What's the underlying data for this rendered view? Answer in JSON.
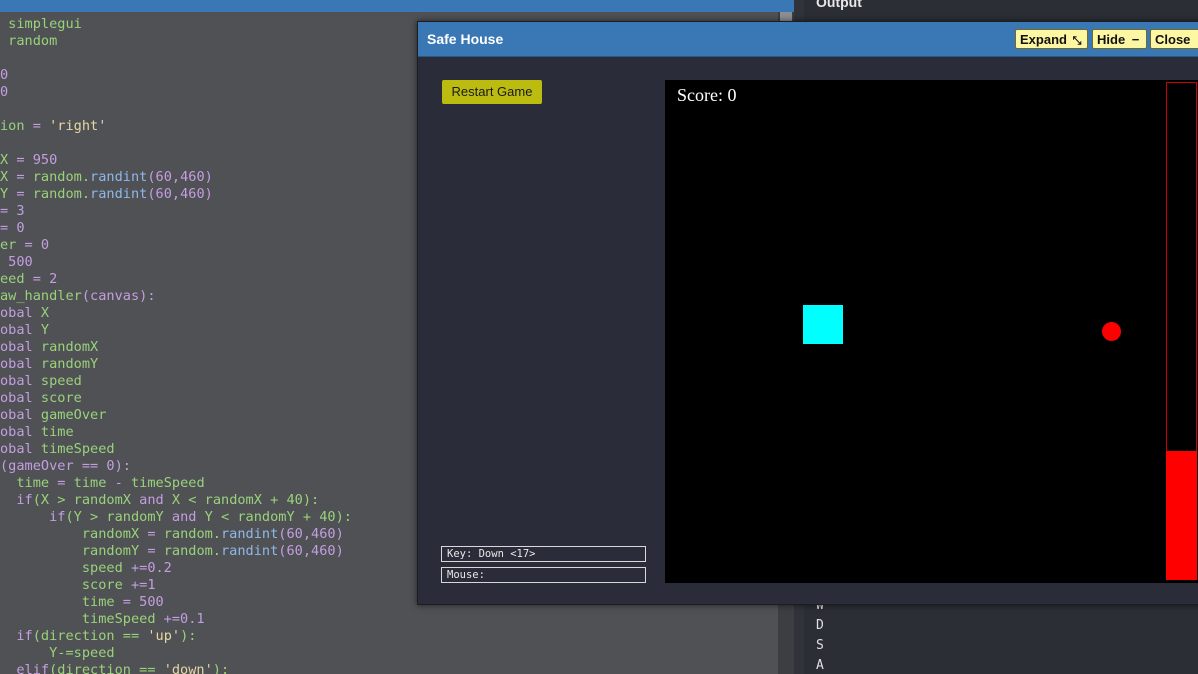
{
  "code_lines": [
    {
      "segs": [
        {
          "t": " simplegui",
          "c": "#9ad27a"
        }
      ]
    },
    {
      "segs": [
        {
          "t": " random",
          "c": "#9ad27a"
        }
      ]
    },
    {
      "segs": []
    },
    {
      "segs": [
        {
          "t": "0",
          "c": "#c49ee0"
        }
      ]
    },
    {
      "segs": [
        {
          "t": "0",
          "c": "#c49ee0"
        }
      ]
    },
    {
      "segs": []
    },
    {
      "segs": [
        {
          "t": "ion",
          "c": "#9ad27a"
        },
        {
          "t": " = ",
          "c": "#c49ee0"
        },
        {
          "t": "'right'",
          "c": "#e6d7a3"
        }
      ]
    },
    {
      "segs": []
    },
    {
      "segs": [
        {
          "t": "X",
          "c": "#9ad27a"
        },
        {
          "t": " = 950",
          "c": "#c49ee0"
        }
      ]
    },
    {
      "segs": [
        {
          "t": "X",
          "c": "#9ad27a"
        },
        {
          "t": " = ",
          "c": "#c49ee0"
        },
        {
          "t": "random.",
          "c": "#9ad27a"
        },
        {
          "t": "randint",
          "c": "#8fb8e8"
        },
        {
          "t": "(60,460)",
          "c": "#c49ee0"
        }
      ]
    },
    {
      "segs": [
        {
          "t": "Y",
          "c": "#9ad27a"
        },
        {
          "t": " = ",
          "c": "#c49ee0"
        },
        {
          "t": "random.",
          "c": "#9ad27a"
        },
        {
          "t": "randint",
          "c": "#8fb8e8"
        },
        {
          "t": "(60,460)",
          "c": "#c49ee0"
        }
      ]
    },
    {
      "segs": [
        {
          "t": "= 3",
          "c": "#c49ee0"
        }
      ]
    },
    {
      "segs": [
        {
          "t": "= 0",
          "c": "#c49ee0"
        }
      ]
    },
    {
      "segs": [
        {
          "t": "er",
          "c": "#9ad27a"
        },
        {
          "t": " = 0",
          "c": "#c49ee0"
        }
      ]
    },
    {
      "segs": [
        {
          "t": " 500",
          "c": "#c49ee0"
        }
      ]
    },
    {
      "segs": [
        {
          "t": "eed",
          "c": "#9ad27a"
        },
        {
          "t": " = 2",
          "c": "#c49ee0"
        }
      ]
    },
    {
      "segs": [
        {
          "t": "aw_handler",
          "c": "#9ad27a"
        },
        {
          "t": "(canvas):",
          "c": "#c49ee0"
        }
      ]
    },
    {
      "segs": [
        {
          "t": "obal",
          "c": "#c49ee0"
        },
        {
          "t": " X",
          "c": "#9ad27a"
        }
      ]
    },
    {
      "segs": [
        {
          "t": "obal",
          "c": "#c49ee0"
        },
        {
          "t": " Y",
          "c": "#9ad27a"
        }
      ]
    },
    {
      "segs": [
        {
          "t": "obal",
          "c": "#c49ee0"
        },
        {
          "t": " randomX",
          "c": "#9ad27a"
        }
      ]
    },
    {
      "segs": [
        {
          "t": "obal",
          "c": "#c49ee0"
        },
        {
          "t": " randomY",
          "c": "#9ad27a"
        }
      ]
    },
    {
      "segs": [
        {
          "t": "obal",
          "c": "#c49ee0"
        },
        {
          "t": " speed",
          "c": "#9ad27a"
        }
      ]
    },
    {
      "segs": [
        {
          "t": "obal",
          "c": "#c49ee0"
        },
        {
          "t": " score",
          "c": "#9ad27a"
        }
      ]
    },
    {
      "segs": [
        {
          "t": "obal",
          "c": "#c49ee0"
        },
        {
          "t": " gameOver",
          "c": "#9ad27a"
        }
      ]
    },
    {
      "segs": [
        {
          "t": "obal",
          "c": "#c49ee0"
        },
        {
          "t": " time",
          "c": "#9ad27a"
        }
      ]
    },
    {
      "segs": [
        {
          "t": "obal",
          "c": "#c49ee0"
        },
        {
          "t": " timeSpeed",
          "c": "#9ad27a"
        }
      ]
    },
    {
      "segs": [
        {
          "t": "(gameOver == 0):",
          "c": "#c49ee0"
        }
      ]
    },
    {
      "segs": [
        {
          "t": "  time",
          "c": "#9ad27a"
        },
        {
          "t": " = ",
          "c": "#c49ee0"
        },
        {
          "t": "time",
          "c": "#9ad27a"
        },
        {
          "t": " - ",
          "c": "#c49ee0"
        },
        {
          "t": "timeSpeed",
          "c": "#9ad27a"
        }
      ]
    },
    {
      "segs": [
        {
          "t": "  if",
          "c": "#c49ee0"
        },
        {
          "t": "(X > randomX ",
          "c": "#9ad27a"
        },
        {
          "t": "and",
          "c": "#c49ee0"
        },
        {
          "t": " X < randomX + 40):",
          "c": "#9ad27a"
        }
      ]
    },
    {
      "segs": [
        {
          "t": "      if",
          "c": "#c49ee0"
        },
        {
          "t": "(Y > randomY ",
          "c": "#9ad27a"
        },
        {
          "t": "and",
          "c": "#c49ee0"
        },
        {
          "t": " Y < randomY + 40):",
          "c": "#9ad27a"
        }
      ]
    },
    {
      "segs": [
        {
          "t": "          randomX",
          "c": "#9ad27a"
        },
        {
          "t": " = ",
          "c": "#c49ee0"
        },
        {
          "t": "random.",
          "c": "#9ad27a"
        },
        {
          "t": "randint",
          "c": "#8fb8e8"
        },
        {
          "t": "(60,460)",
          "c": "#c49ee0"
        }
      ]
    },
    {
      "segs": [
        {
          "t": "          randomY",
          "c": "#9ad27a"
        },
        {
          "t": " = ",
          "c": "#c49ee0"
        },
        {
          "t": "random.",
          "c": "#9ad27a"
        },
        {
          "t": "randint",
          "c": "#8fb8e8"
        },
        {
          "t": "(60,460)",
          "c": "#c49ee0"
        }
      ]
    },
    {
      "segs": [
        {
          "t": "          speed",
          "c": "#9ad27a"
        },
        {
          "t": " +=0.2",
          "c": "#c49ee0"
        }
      ]
    },
    {
      "segs": [
        {
          "t": "          score",
          "c": "#9ad27a"
        },
        {
          "t": " +=1",
          "c": "#c49ee0"
        }
      ]
    },
    {
      "segs": [
        {
          "t": "          time",
          "c": "#9ad27a"
        },
        {
          "t": " = 500",
          "c": "#c49ee0"
        }
      ]
    },
    {
      "segs": [
        {
          "t": "          timeSpeed",
          "c": "#9ad27a"
        },
        {
          "t": " +=0.1",
          "c": "#c49ee0"
        }
      ]
    },
    {
      "segs": [
        {
          "t": "  if",
          "c": "#c49ee0"
        },
        {
          "t": "(direction == ",
          "c": "#9ad27a"
        },
        {
          "t": "'up'",
          "c": "#e6d7a3"
        },
        {
          "t": "):",
          "c": "#9ad27a"
        }
      ]
    },
    {
      "segs": [
        {
          "t": "      Y-=speed",
          "c": "#9ad27a"
        }
      ]
    },
    {
      "segs": [
        {
          "t": "  elif",
          "c": "#c49ee0"
        },
        {
          "t": "(direction == ",
          "c": "#9ad27a"
        },
        {
          "t": "'down'",
          "c": "#e6d7a3"
        },
        {
          "t": "):",
          "c": "#9ad27a"
        }
      ]
    }
  ],
  "output": {
    "title": "Output",
    "lines": [
      "W",
      "D",
      "S",
      "A"
    ]
  },
  "window": {
    "title": "Safe House",
    "expand_label": "Expand",
    "hide_label": "Hide",
    "close_label": "Close"
  },
  "game": {
    "restart_label": "Restart Game",
    "key_status": "Key: Down <17>",
    "mouse_status": "Mouse:",
    "score_text": "Score: 0",
    "time_remaining_fraction": 0.26
  },
  "colors": {
    "player": "#00ffff",
    "target": "#ff0000",
    "time_bar": "#ff0000",
    "button_yellow": "#fdf6a2",
    "restart_button": "#bcbc10"
  }
}
